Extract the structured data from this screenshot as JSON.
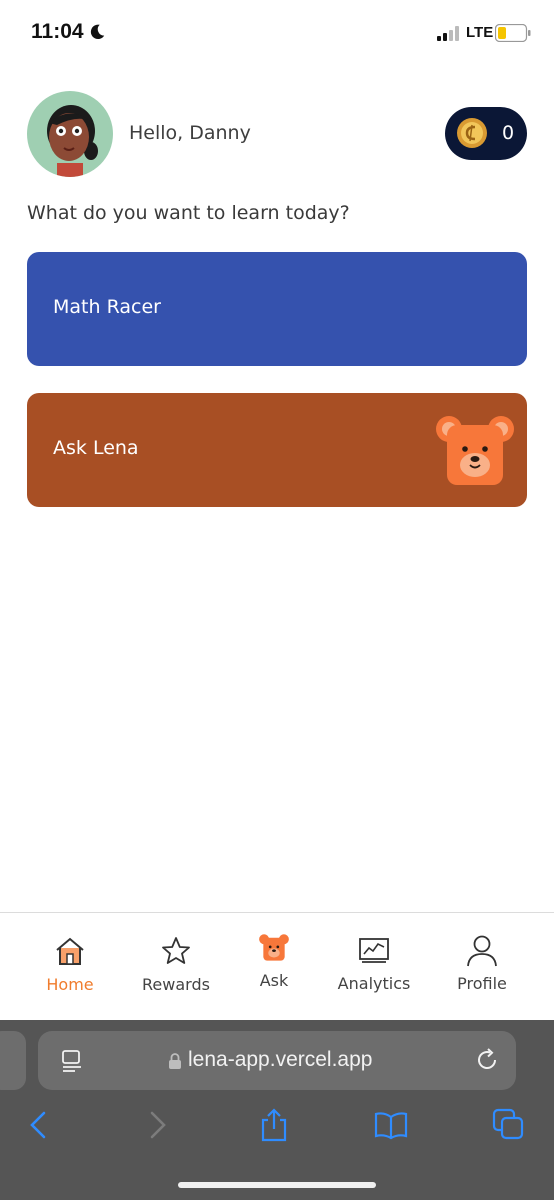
{
  "status_bar": {
    "time": "11:04",
    "network": "LTE"
  },
  "header": {
    "greeting": "Hello, Danny",
    "coins": "0"
  },
  "prompt": "What do you want to learn today?",
  "cards": [
    {
      "label": "Math Racer",
      "color": "#3552ae"
    },
    {
      "label": "Ask Lena",
      "color": "#a84f24"
    }
  ],
  "tabs": [
    {
      "label": "Home",
      "icon": "house-icon",
      "active": true
    },
    {
      "label": "Rewards",
      "icon": "star-icon"
    },
    {
      "label": "Ask",
      "icon": "bear-icon"
    },
    {
      "label": "Analytics",
      "icon": "analytics-icon"
    },
    {
      "label": "Profile",
      "icon": "person-icon"
    }
  ],
  "browser": {
    "url": "lena-app.vercel.app"
  },
  "colors": {
    "accent": "#f07c2d",
    "coin_pill": "#0b1736"
  }
}
